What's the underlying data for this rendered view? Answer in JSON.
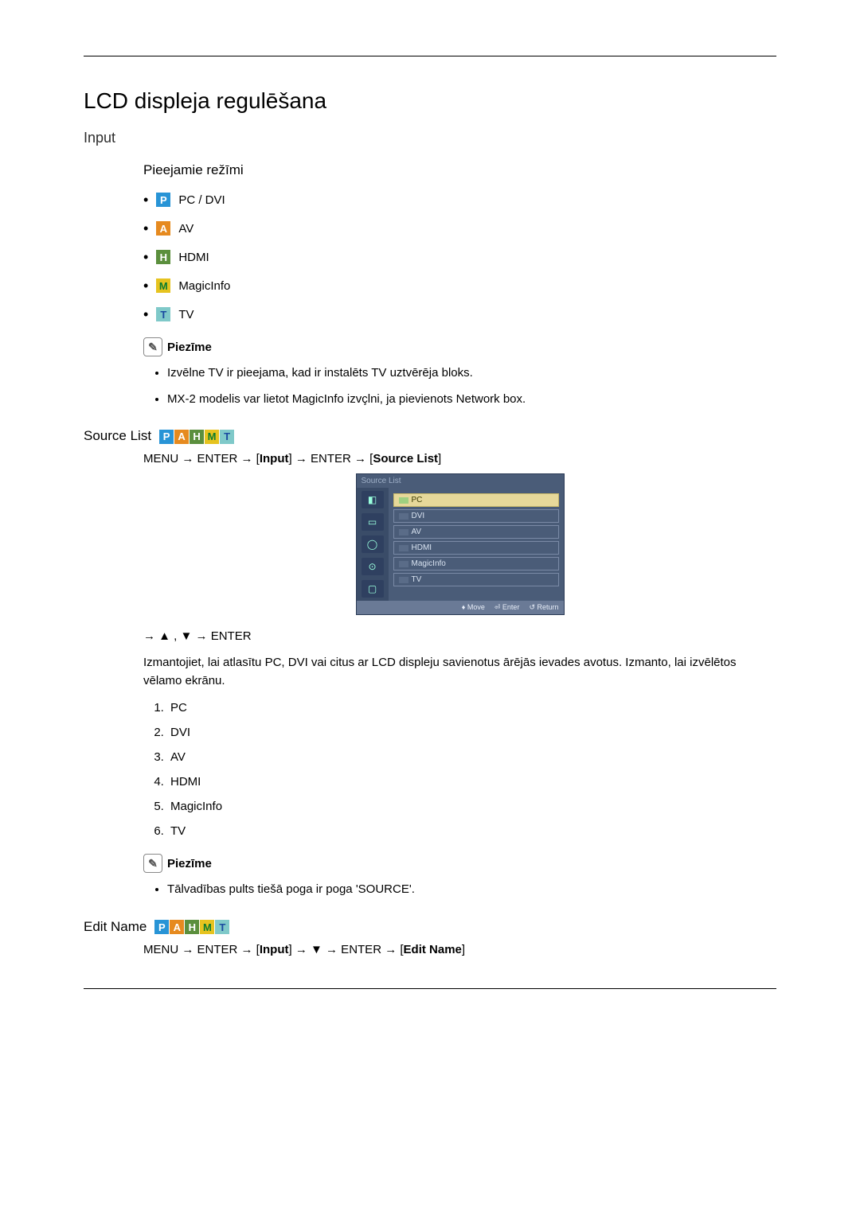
{
  "page_title": "LCD displeja regulēšana",
  "section_input": "Input",
  "avail_modes_heading": "Pieejamie režīmi",
  "modes": {
    "pcdvi": "PC / DVI",
    "av": "AV",
    "hdmi": "HDMI",
    "magicinfo": "MagicInfo",
    "tv": "TV"
  },
  "note_label": "Piezīme",
  "note1_items": [
    "Izvēlne TV ir pieejama, kad ir instalēts TV uztvērēja bloks.",
    "MX-2 modelis var lietot MagicInfo izvçlni, ja pievienots Network box."
  ],
  "source_list_heading": "Source List",
  "source_list_path": {
    "prefix": "MENU → ENTER → [",
    "input": "Input",
    "mid": "] → ENTER → [",
    "sourcelist": "Source List",
    "suffix": "]"
  },
  "osd": {
    "title": "Source List",
    "items": [
      "PC",
      "DVI",
      "AV",
      "HDMI",
      "MagicInfo",
      "TV"
    ],
    "selected_index": 0,
    "footer": {
      "move": "Move",
      "enter": "Enter",
      "return": "Return"
    }
  },
  "nav_after_osd": "→ ▲ , ▼ → ENTER",
  "source_list_para": "Izmantojiet, lai atlasītu PC, DVI vai citus ar LCD displeju savienotus ārējās ievades avotus. Izmanto, lai izvēlētos vēlamo ekrānu.",
  "source_list_numbered": [
    "PC",
    "DVI",
    "AV",
    "HDMI",
    "MagicInfo",
    "TV"
  ],
  "note2_items": [
    "Tālvadības pults tiešā poga ir poga 'SOURCE'."
  ],
  "edit_name_heading": "Edit Name",
  "edit_name_path": {
    "prefix": "MENU → ENTER → [",
    "input": "Input",
    "mid": "] → ▼ → ENTER → [",
    "editname": "Edit Name",
    "suffix": "]"
  },
  "badge_letters": {
    "p": "P",
    "a": "A",
    "h": "H",
    "m": "M",
    "t": "T"
  }
}
